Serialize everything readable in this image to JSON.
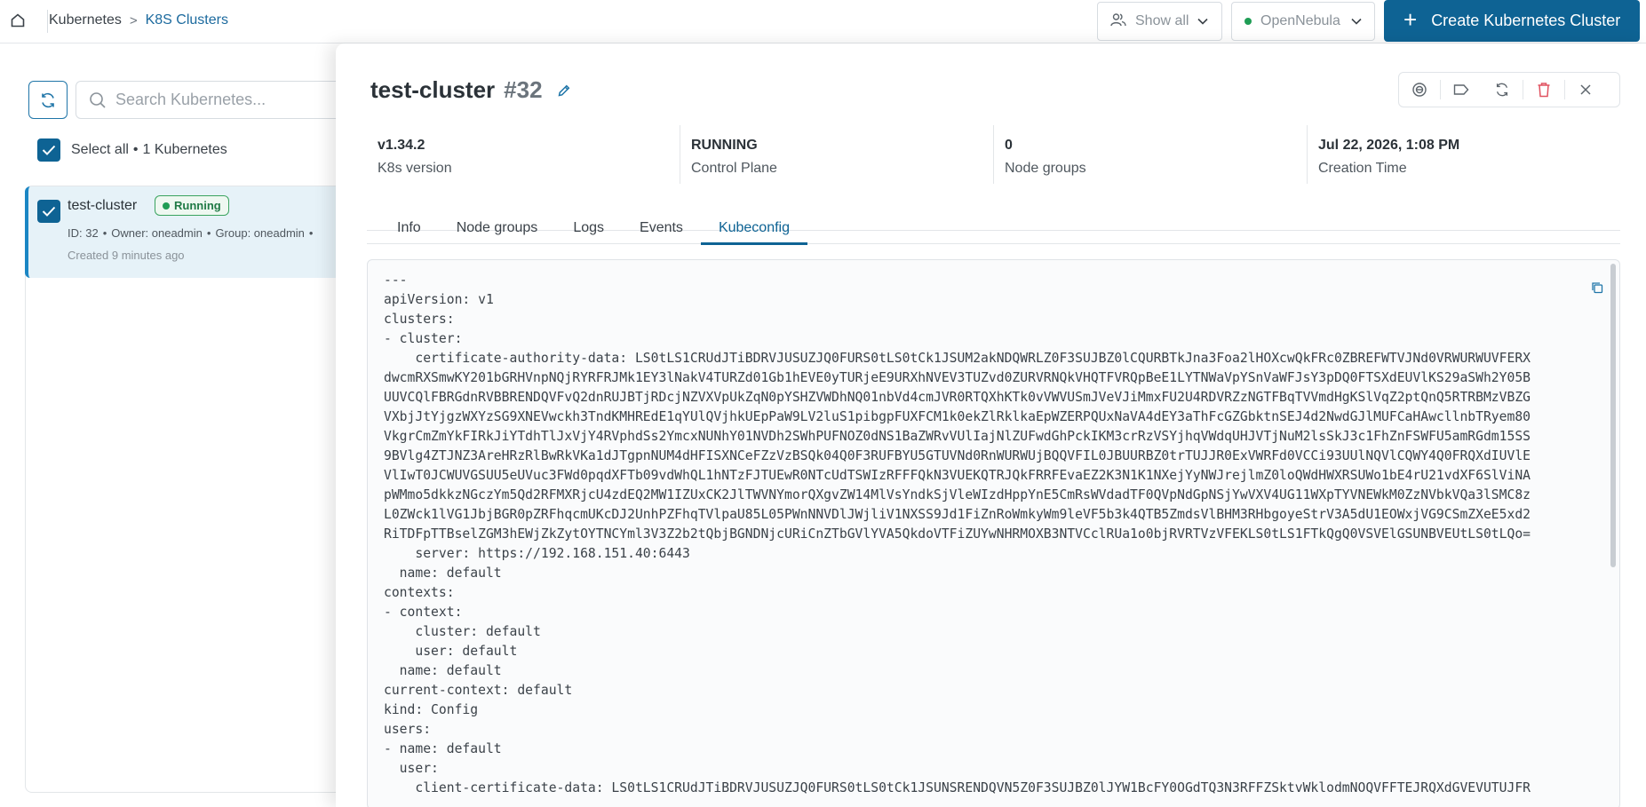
{
  "breadcrumb": {
    "items": [
      "Kubernetes",
      "K8S Clusters"
    ],
    "separator": ">"
  },
  "toolbar": {
    "filter_label": "Show all",
    "zone_label": "OpenNebula",
    "create_label": "Create Kubernetes Cluster",
    "accent_color": "#0e6394"
  },
  "list": {
    "search_placeholder": "Search Kubernetes...",
    "select_all_label": "Select all",
    "count_label": "1 Kubernetes",
    "clusters": [
      {
        "name": "test-cluster",
        "status": "Running",
        "id": "ID: 32",
        "owner": "Owner: oneadmin",
        "group": "Group: oneadmin",
        "created": "Created 9 minutes ago"
      }
    ]
  },
  "detail": {
    "name": "test-cluster",
    "number": "#32",
    "stats": [
      {
        "value": "v1.34.2",
        "label": "K8s version"
      },
      {
        "value": "RUNNING",
        "label": "Control Plane"
      },
      {
        "value": "0",
        "label": "Node groups"
      },
      {
        "value": "Jul 22, 2026, 1:08 PM",
        "label": "Creation Time"
      }
    ],
    "tabs": [
      "Info",
      "Node groups",
      "Logs",
      "Events",
      "Kubeconfig"
    ],
    "active_tab": "Kubeconfig",
    "kubeconfig": "---\napiVersion: v1\nclusters:\n- cluster:\n    certificate-authority-data: LS0tLS1CRUdJTiBDRVJUSUZJQ0FURS0tLS0tCk1JSUM2akNDQWRLZ0F3SUJBZ0lCQURBTkJna3Foa2lHOXcwQkFRc0ZBREFWTVJNd0VRWURWUVFERX\ndwcmRXSmwKY201bGRHVnpNQjRYRFRJMk1EY3lNakV4TURZd01Gb1hEVE0yTURjeE9URXhNVEV3TUZvd0ZURVRNQkVHQTFVRQpBeE1LYTNWaVpYSnVaWFJsY3pDQ0FTSXdEUVlKS29aSWh2Y05B\nUUVCQlFBRGdnRVBBRENDQVFvQ2dnRUJBTjRDcjNZVXVpUkZqN0pYSHZVWDhNQ01nbVd4cmJVR0RTQXhKTk0vVWVUSmJVeVJiMmxFU2U4RDVRZzNGTFBqTVVmdHgKSlVqZ2ptQnQ5RTRBMzVBZG\nVXbjJtYjgzWXYzSG9XNEVwckh3TndKMHREdE1qYUlQVjhkUEpPaW9LV2luS1pibgpFUXFCM1k0ekZlRklkaEpWZERPQUxNaVA4dEY3aThFcGZGbktnSEJ4d2NwdGJlMUFCaHAwcllnbTRyem80\nVkgrCmZmYkFIRkJiYTdhTlJxVjY4RVphdSs2YmcxNUNhY01NVDh2SWhPUFNOZ0dNS1BaZWRvVUlIajNlZUFwdGhPckIKM3crRzVSYjhqVWdqUHJVTjNuM2lsSkJ3c1FhZnFSWFU5amRGdm15SS\n9BVlg4ZTJNZ3AreHRzRlBwRkVKa1dJTgpnNUM4dHFISXNCeFZzVzBSQk04Q0F3RUFBYU5GTUVNd0RnWURWUjBQQVFIL0JBUURBZ0trTUJJR0ExVWRFd0VCCi93UUlNQVlCQWY4Q0FRQXdIUVlE\nVlIwT0JCWUVGSUU5eUVuc3FWd0pqdXFTb09vdWhQL1hNTzFJTUEwR0NTcUdTSWIzRFFFQkN3VUEKQTRJQkFRRFEvaEZ2K3N1K1NXejYyNWJrejlmZ0loQWdHWXRSUWo1bE4rU21vdXF6SlViNA\npWMmo5dkkzNGczYm5Qd2RFMXRjcU4zdEQ2MW1IZUxCK2JlTWVNYmorQXgvZW14MlVsYndkSjVleWIzdHppYnE5CmRsWVdadTF0QVpNdGpNSjYwVXV4UG11WXpTYVNEWkM0ZzNVbkVQa3lSMC8z\nL0ZWck1lVG1JbjBGR0pZRFhqcmUKcDJ2UnhPZFhqTVlpaU85L05PWnNNVDlJWjliV1NXSS9Jd1FiZnRoWmkyWm9leVF5b3k4QTB5ZmdsVlBHM3RHbgoyeStrV3A5dU1EOWxjVG9CSmZXeE5xd2\nRiTDFpTTBselZGM3hEWjZkZytOYTNCYml3V3Z2b2tQbjBGNDNjcURiCnZTbGVlYVA5QkdoVTFiZUYwNHRMOXB3NTVCclRUa1o0bjRVRTVzVFEKLS0tLS1FTkQgQ0VSVElGSUNBVEUtLS0tLQo=\n    server: https://192.168.151.40:6443\n  name: default\ncontexts:\n- context:\n    cluster: default\n    user: default\n  name: default\ncurrent-context: default\nkind: Config\nusers:\n- name: default\n  user:\n    client-certificate-data: LS0tLS1CRUdJTiBDRVJUSUZJQ0FURS0tLS0tCk1JSUNSRENDQVN5Z0F3SUJBZ0lJYW1BcFY0OGdTQ3N3RFFZSktvWklodmNOQVFFTEJRQXdGVEVUTUJFR"
  }
}
